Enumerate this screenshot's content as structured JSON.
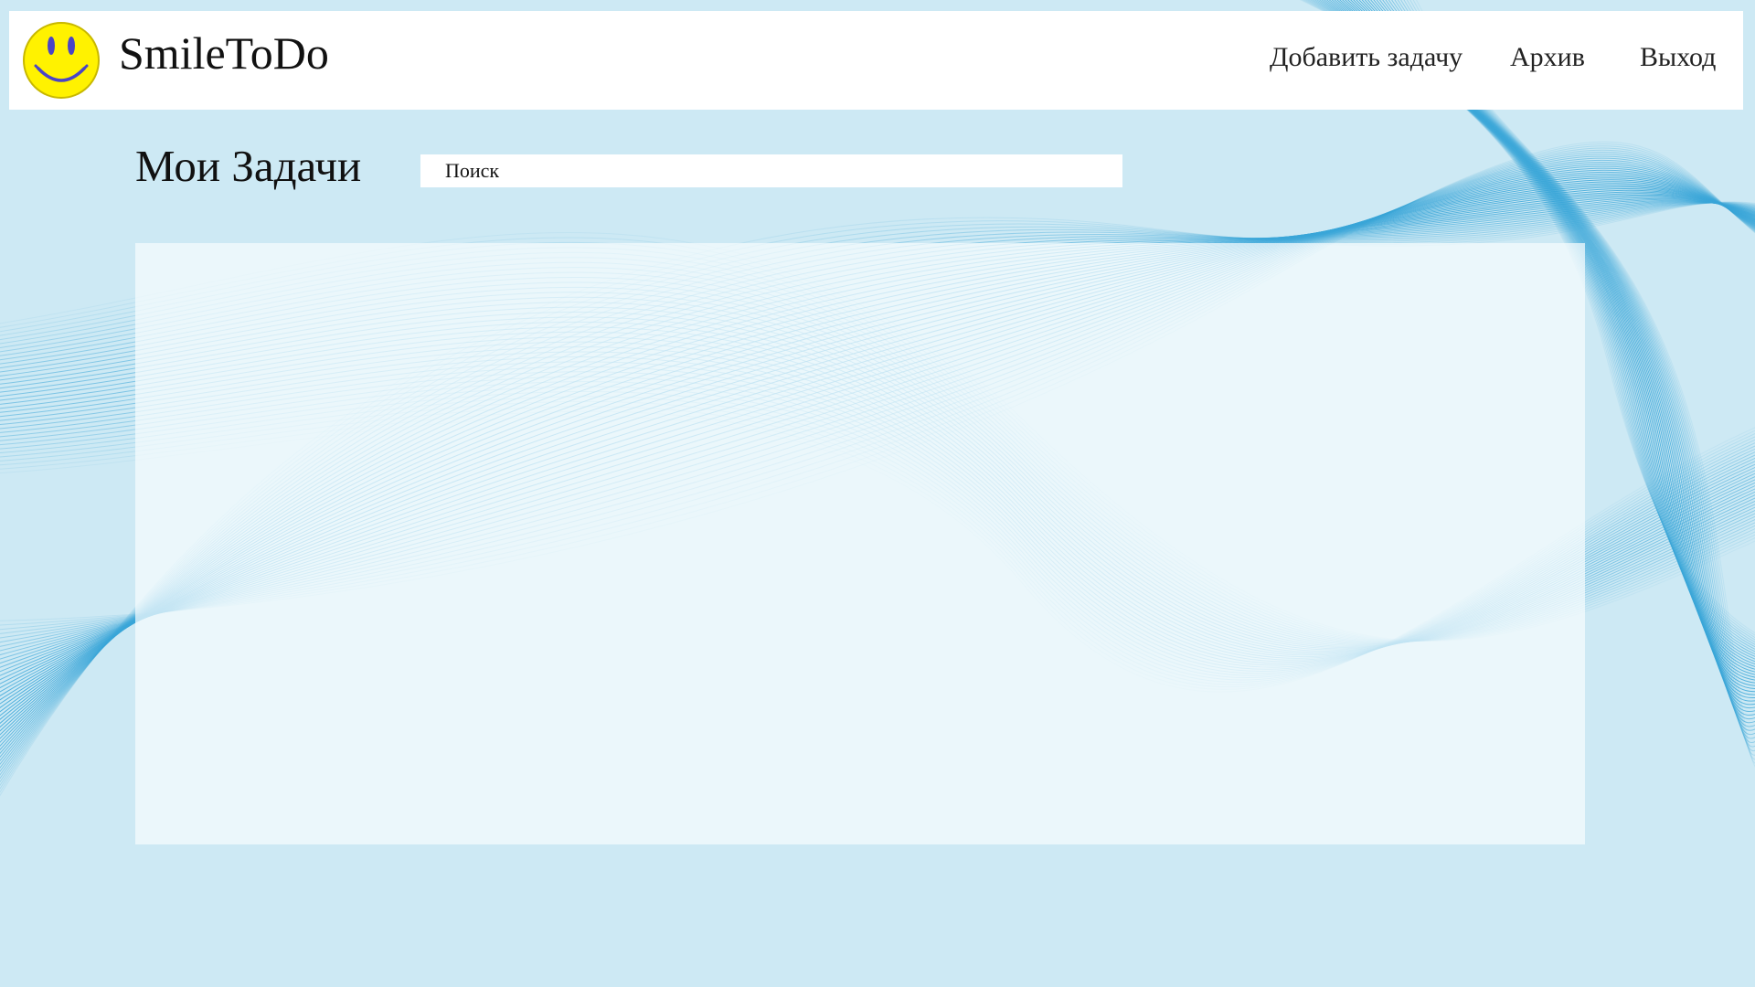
{
  "app": {
    "brand": "SmileToDo"
  },
  "nav": {
    "add_task": "Добавить задачу",
    "archive": "Архив",
    "exit": "Выход"
  },
  "main": {
    "title": "Мои Задачи",
    "search": {
      "placeholder": "Поиск",
      "value": ""
    },
    "tasks": []
  },
  "theme": {
    "background": "#cde9f4",
    "header_background": "#ffffff",
    "panel_background": "#f6fcfe",
    "wave_line": "#3aa6d8",
    "logo_face": "#fff200",
    "logo_features": "#4a44c6"
  },
  "icons": {
    "logo": "smiley-face-icon"
  }
}
